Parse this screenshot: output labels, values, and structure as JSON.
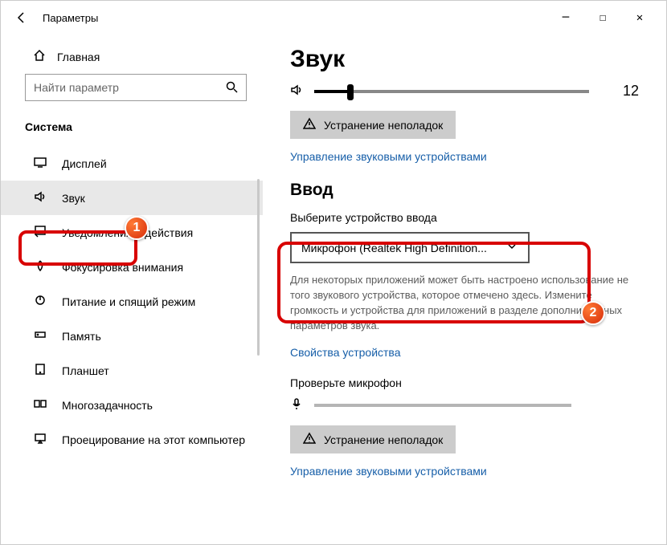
{
  "titlebar": {
    "title": "Параметры"
  },
  "sidebar": {
    "home": "Главная",
    "search_placeholder": "Найти параметр",
    "section": "Система",
    "items": [
      {
        "label": "Дисплей"
      },
      {
        "label": "Звук",
        "selected": true
      },
      {
        "label": "Уведомления и действия"
      },
      {
        "label": "Фокусировка внимания"
      },
      {
        "label": "Питание и спящий режим"
      },
      {
        "label": "Память"
      },
      {
        "label": "Планшет"
      },
      {
        "label": "Многозадачность"
      },
      {
        "label": "Проецирование на этот компьютер"
      }
    ]
  },
  "main": {
    "heading": "Звук",
    "volume_value": "12",
    "troubleshoot": "Устранение неполадок",
    "manage_devices": "Управление звуковыми устройствами",
    "input_heading": "Ввод",
    "input_choose_label": "Выберите устройство ввода",
    "input_selected": "Микрофон (Realtek High Definition...",
    "input_hint": "Для некоторых приложений может быть настроено использование не того звукового устройства, которое отмечено здесь. Измените громкость и устройства для приложений в разделе дополнительных параметров звука.",
    "device_props": "Свойства устройства",
    "test_mic": "Проверьте микрофон",
    "troubleshoot2": "Устранение неполадок",
    "manage_devices2": "Управление звуковыми устройствами"
  },
  "annotations": {
    "badge1": "1",
    "badge2": "2"
  }
}
